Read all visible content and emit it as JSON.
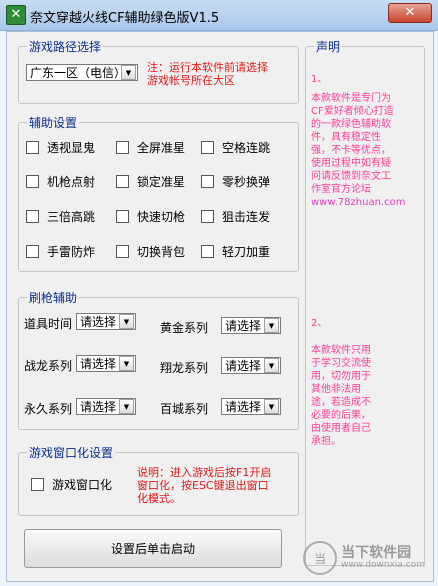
{
  "window": {
    "title": "奈文穿越火线CF辅助绿色版V1.5",
    "close": "✕"
  },
  "groups": {
    "path": "游戏路径选择",
    "assist": "辅助设置",
    "gun": "刷枪辅助",
    "windowed": "游戏窗口化设置"
  },
  "region": {
    "value": "广东一区（电信）"
  },
  "notice": [
    "注：运行本软件前请选择",
    "游戏帐号所在大区"
  ],
  "assist_options": [
    "透视显鬼",
    "全屏准星",
    "空格连跳",
    "机枪点射",
    "锁定准星",
    "零秒换弹",
    "三倍高跳",
    "快速切枪",
    "狙击连发",
    "手雷防炸",
    "切换背包",
    "轻刀加重"
  ],
  "gun_rows": [
    {
      "left_label": "道具时间",
      "left_value": "请选择",
      "right_label": "黄金系列",
      "right_value": "请选择"
    },
    {
      "left_label": "战龙系列",
      "left_value": "请选择",
      "right_label": "翔龙系列",
      "right_value": "请选择"
    },
    {
      "left_label": "永久系列",
      "left_value": "请选择",
      "right_label": "百城系列",
      "right_value": "请选择"
    }
  ],
  "windowed_option": "游戏窗口化",
  "windowed_note": [
    "说明：进入游戏后按F1开启",
    "窗口化，按ESC键退出窗口",
    "化模式。"
  ],
  "statement": {
    "title": "声明",
    "p1_num": "1、",
    "p1": [
      "本款软件是专门为",
      "CF爱好者倾心打造",
      "的一款绿色辅助软",
      "件，具有稳定性",
      "强，不卡等优点，",
      "使用过程中如有疑",
      "问请反馈到奈文工",
      "作室官方论坛"
    ],
    "site": "www.78zhuan.com",
    "p2_num": "2、",
    "p2": [
      "本款软件只用",
      "于学习交流使",
      "用，切勿用于",
      "其他非法用",
      "途，若造成不",
      "必要的后果，",
      "由使用者自己",
      "承担。"
    ]
  },
  "start_button": "设置后单击启动",
  "watermark": {
    "logo": "当",
    "name": "当下软件园",
    "url": "www.downxia.com"
  }
}
